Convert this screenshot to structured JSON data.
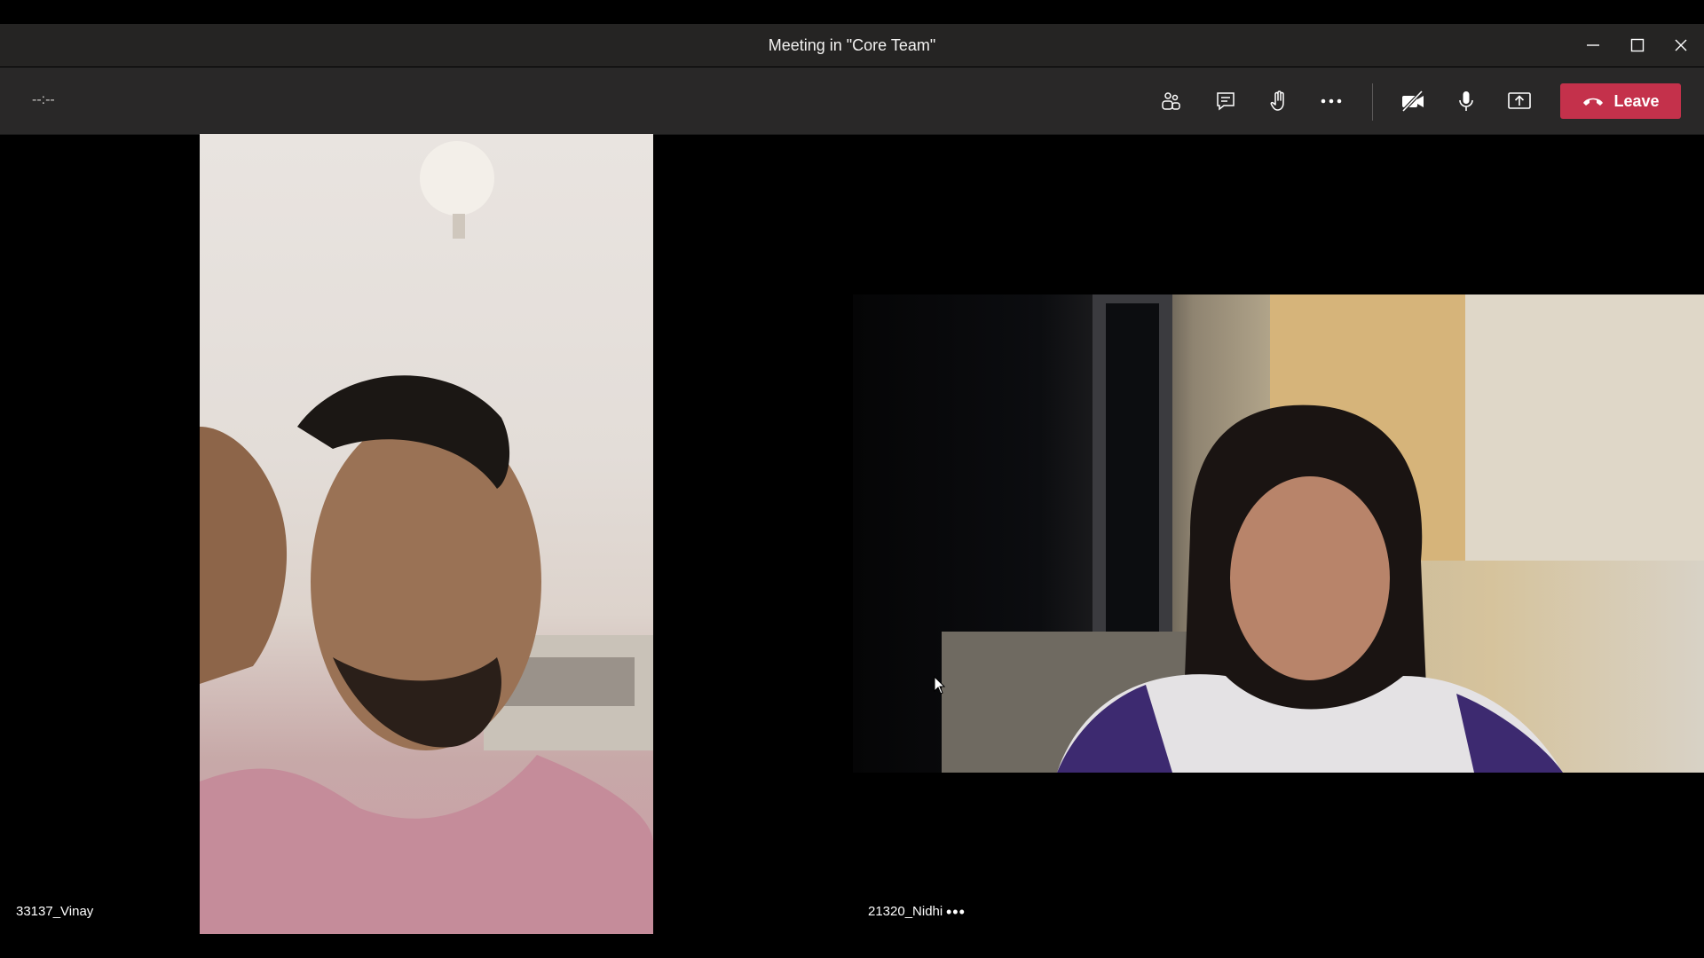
{
  "window": {
    "title": "Meeting in \"Core Team\"",
    "controls": [
      "minimize-icon",
      "maximize-icon",
      "close-icon"
    ]
  },
  "toolbar": {
    "timer": "--:--",
    "buttons": [
      "participants-icon",
      "chat-icon",
      "raise-hand-icon",
      "more-actions-icon",
      "camera-off-icon",
      "microphone-icon",
      "share-screen-icon"
    ],
    "leave_label": "Leave",
    "leave_color": "#c4314b"
  },
  "participants": [
    {
      "name": "33137_Vinay"
    },
    {
      "name": "21320_Nidhi",
      "more": "•••"
    }
  ]
}
